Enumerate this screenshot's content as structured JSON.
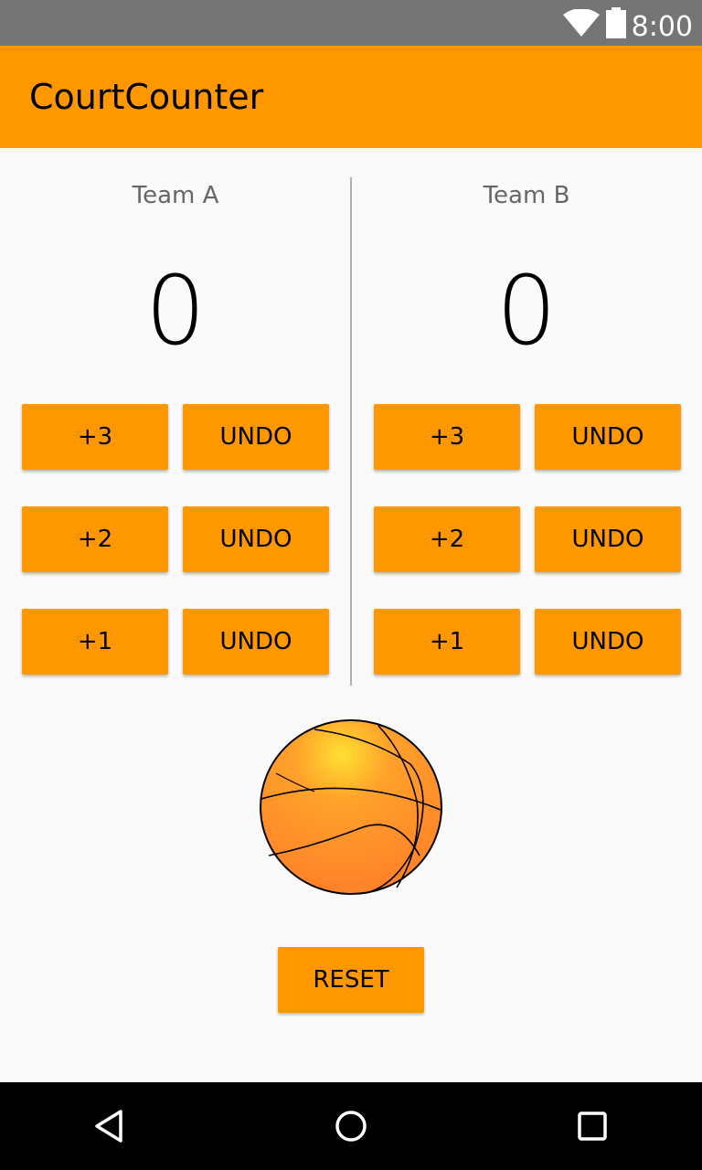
{
  "status_bar": {
    "time": "8:00",
    "icons": [
      "wifi-icon",
      "battery-icon"
    ]
  },
  "app_bar": {
    "title": "CourtCounter"
  },
  "team_a": {
    "name": "Team A",
    "score": "0",
    "buttons": [
      {
        "add_label": "+3",
        "undo_label": "UNDO"
      },
      {
        "add_label": "+2",
        "undo_label": "UNDO"
      },
      {
        "add_label": "+1",
        "undo_label": "UNDO"
      }
    ]
  },
  "team_b": {
    "name": "Team B",
    "score": "0",
    "buttons": [
      {
        "add_label": "+3",
        "undo_label": "UNDO"
      },
      {
        "add_label": "+2",
        "undo_label": "UNDO"
      },
      {
        "add_label": "+1",
        "undo_label": "UNDO"
      }
    ]
  },
  "reset_label": "RESET",
  "nav_bar": {
    "icons": [
      "back-icon",
      "home-icon",
      "recents-icon"
    ]
  },
  "colors": {
    "accent": "#ff9800",
    "status_bar": "#757575",
    "background": "#fafafa",
    "ball": "#ff8a2b"
  }
}
